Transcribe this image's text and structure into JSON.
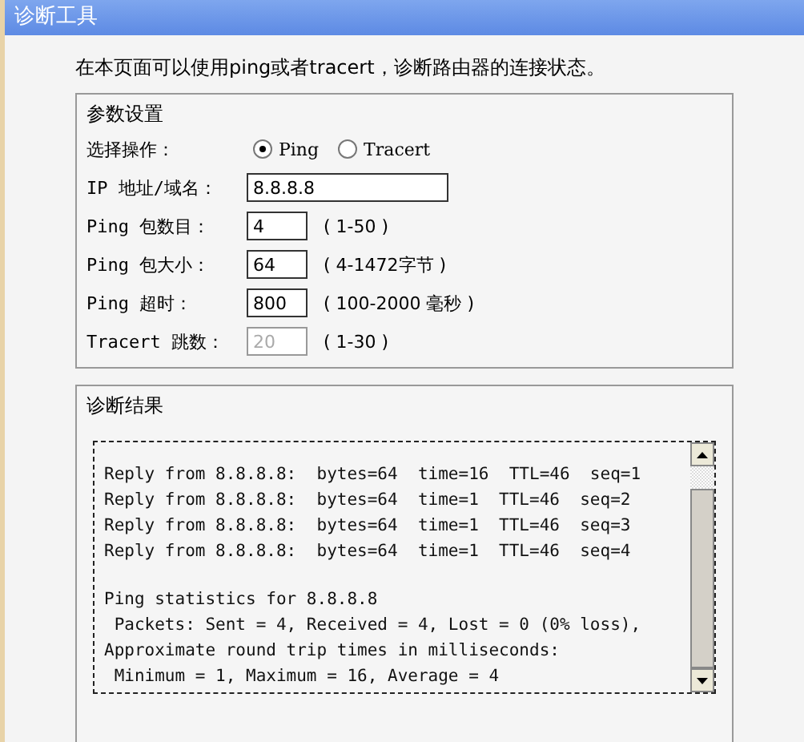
{
  "window": {
    "title": "诊断工具"
  },
  "intro": "在本页面可以使用ping或者tracert，诊断路由器的连接状态。",
  "params": {
    "title": "参数设置",
    "rows": [
      {
        "kind": "radio",
        "label": "选择操作：",
        "options": [
          {
            "label": "Ping",
            "selected": true
          },
          {
            "label": "Tracert",
            "selected": false
          }
        ]
      },
      {
        "kind": "address",
        "label": "IP 地址/域名：",
        "value": "8.8.8.8",
        "disabled": false
      },
      {
        "kind": "input",
        "label": "Ping 包数目：",
        "value": "4",
        "hint": "( 1-50 )",
        "disabled": false
      },
      {
        "kind": "input",
        "label": "Ping 包大小：",
        "value": "64",
        "hint": "( 4-1472字节 )",
        "disabled": false
      },
      {
        "kind": "input",
        "label": "Ping 超时：",
        "value": "800",
        "hint": "( 100-2000 毫秒 )",
        "disabled": false
      },
      {
        "kind": "input",
        "label": "Tracert 跳数：",
        "value": "20",
        "hint": "( 1-30 )",
        "disabled": true
      }
    ]
  },
  "results": {
    "title": "诊断结果",
    "blocks": [
      [
        "Reply from 8.8.8.8:  bytes=64  time=16  TTL=46  seq=1",
        "Reply from 8.8.8.8:  bytes=64  time=1  TTL=46  seq=2",
        "Reply from 8.8.8.8:  bytes=64  time=1  TTL=46  seq=3",
        "Reply from 8.8.8.8:  bytes=64  time=1  TTL=46  seq=4"
      ],
      [
        "Ping statistics for 8.8.8.8",
        " Packets: Sent = 4, Received = 4, Lost = 0 (0% loss),",
        "Approximate round trip times in milliseconds:",
        " Minimum = 1, Maximum = 16, Average = 4"
      ]
    ]
  }
}
